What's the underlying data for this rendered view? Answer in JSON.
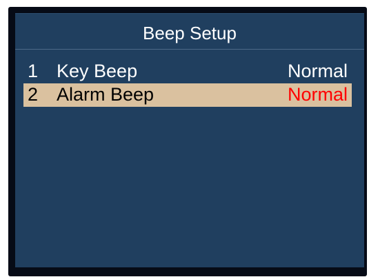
{
  "screen": {
    "title": "Beep Setup"
  },
  "menu": {
    "items": [
      {
        "number": "1",
        "label": "Key Beep",
        "value": "Normal",
        "selected": false
      },
      {
        "number": "2",
        "label": "Alarm Beep",
        "value": "Normal",
        "selected": true
      }
    ]
  },
  "colors": {
    "screen_background": "#203f5f",
    "bezel": "#060b16",
    "selection_highlight": "#dac19f",
    "selected_value_text": "#ff0000",
    "normal_text": "#ffffff"
  }
}
